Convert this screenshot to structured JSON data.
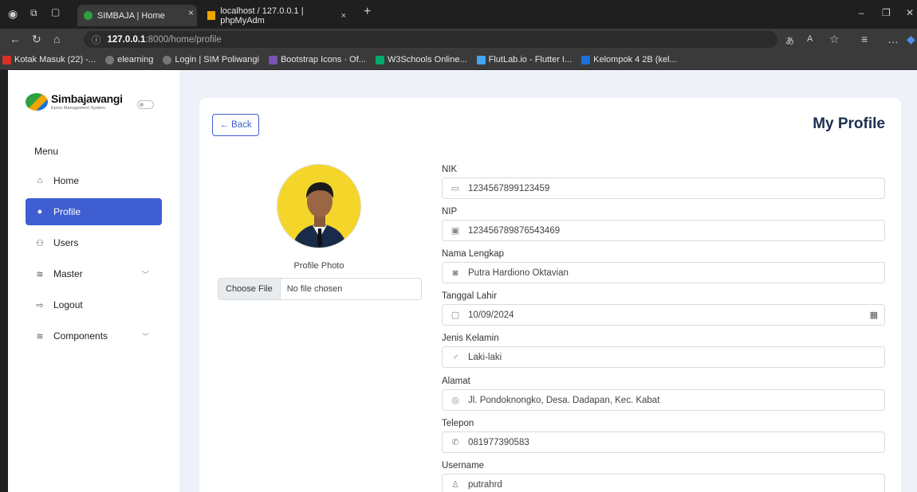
{
  "browser": {
    "tabs": [
      {
        "title": "SIMBAJA | Home",
        "close": "×"
      },
      {
        "title": "localhost / 127.0.0.1 | phpMyAdm",
        "close": "×"
      }
    ],
    "new_tab": "+",
    "url_host": "127.0.0.1",
    "url_rest": ":8000/home/profile",
    "bookmarks": [
      "Kotak Masuk (22) -...",
      "elearning",
      "Login | SIM Poliwangi",
      "Bootstrap Icons · Of...",
      "W3Schools Online...",
      "FlutLab.io - Flutter I...",
      "Kelompok 4 2B (kel..."
    ]
  },
  "sidebar": {
    "brand": "Simbajawangi",
    "brand_sub": "Eproc Management System",
    "menu_title": "Menu",
    "items": [
      {
        "label": "Home",
        "icon": "house-icon",
        "glyph": "⌂"
      },
      {
        "label": "Profile",
        "icon": "person-icon",
        "glyph": "●"
      },
      {
        "label": "Users",
        "icon": "people-icon",
        "glyph": "⚇"
      },
      {
        "label": "Master",
        "icon": "stack-icon",
        "glyph": "≋"
      },
      {
        "label": "Logout",
        "icon": "logout-icon",
        "glyph": "⇨"
      },
      {
        "label": "Components",
        "icon": "stack-icon",
        "glyph": "≋"
      }
    ]
  },
  "main": {
    "back_label": "← Back",
    "title": "My Profile",
    "photo_label": "Profile Photo",
    "file_button": "Choose File",
    "file_status": "No file chosen",
    "fields": [
      {
        "label": "NIK",
        "value": "1234567899123459",
        "icon": "card-icon",
        "glyph": "▭"
      },
      {
        "label": "NIP",
        "value": "123456789876543469",
        "icon": "badge-icon",
        "glyph": "▣"
      },
      {
        "label": "Nama Lengkap",
        "value": "Putra Hardiono Oktavian",
        "icon": "person-badge-icon",
        "glyph": "◙"
      },
      {
        "label": "Tanggal Lahir",
        "value": "10/09/2024",
        "icon": "calendar-icon",
        "glyph": "▢"
      },
      {
        "label": "Jenis Kelamin",
        "value": "Laki-laki",
        "icon": "gender-male-icon",
        "glyph": "♂"
      },
      {
        "label": "Alamat",
        "value": "Jl. Pondoknongko, Desa. Dadapan, Kec. Kabat",
        "icon": "location-icon",
        "glyph": "◎"
      },
      {
        "label": "Telepon",
        "value": "081977390583",
        "icon": "phone-icon",
        "glyph": "✆"
      },
      {
        "label": "Username",
        "value": "putrahrd",
        "icon": "user-icon",
        "glyph": "♙"
      }
    ]
  },
  "colors": {
    "accent": "#3f5ed1",
    "page_bg": "#eef2f8",
    "title": "#1c2d50"
  }
}
